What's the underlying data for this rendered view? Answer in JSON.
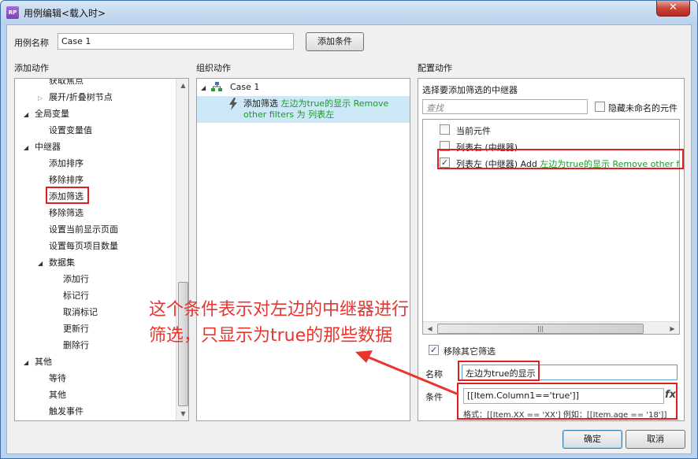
{
  "window": {
    "title": "用例编辑<载入时>",
    "app_icon_text": "RP",
    "close_glyph": "✕"
  },
  "top": {
    "case_name_label": "用例名称",
    "case_name_value": "Case 1",
    "add_condition_button": "添加条件"
  },
  "columns": {
    "add_action": "添加动作",
    "organize_action": "组织动作",
    "configure_action": "配置动作"
  },
  "action_tree": [
    {
      "label": "获取焦点",
      "indent": 2,
      "arrow": ""
    },
    {
      "label": "展开/折叠树节点",
      "indent": 2,
      "arrow": "right"
    },
    {
      "label": "全局变量",
      "indent": 1,
      "arrow": "down"
    },
    {
      "label": "设置变量值",
      "indent": 2,
      "arrow": ""
    },
    {
      "label": "中继器",
      "indent": 1,
      "arrow": "down"
    },
    {
      "label": "添加排序",
      "indent": 2,
      "arrow": ""
    },
    {
      "label": "移除排序",
      "indent": 2,
      "arrow": ""
    },
    {
      "label": "添加筛选",
      "indent": 2,
      "arrow": "",
      "highlight": true
    },
    {
      "label": "移除筛选",
      "indent": 2,
      "arrow": ""
    },
    {
      "label": "设置当前显示页面",
      "indent": 2,
      "arrow": ""
    },
    {
      "label": "设置每页项目数量",
      "indent": 2,
      "arrow": ""
    },
    {
      "label": "数据集",
      "indent": 2,
      "arrow": "down"
    },
    {
      "label": "添加行",
      "indent": 3,
      "arrow": ""
    },
    {
      "label": "标记行",
      "indent": 3,
      "arrow": ""
    },
    {
      "label": "取消标记",
      "indent": 3,
      "arrow": ""
    },
    {
      "label": "更新行",
      "indent": 3,
      "arrow": ""
    },
    {
      "label": "删除行",
      "indent": 3,
      "arrow": ""
    },
    {
      "label": "其他",
      "indent": 1,
      "arrow": "down"
    },
    {
      "label": "等待",
      "indent": 2,
      "arrow": ""
    },
    {
      "label": "其他",
      "indent": 2,
      "arrow": ""
    },
    {
      "label": "触发事件",
      "indent": 2,
      "arrow": ""
    }
  ],
  "organize": {
    "case_label": "Case 1",
    "action_verb": "添加筛选",
    "action_name": "左边为true的显示",
    "action_mid": "Remove other filters 为",
    "action_target": "列表左"
  },
  "configure": {
    "heading": "选择要添加筛选的中继器",
    "search_placeholder": "查找",
    "hide_unnamed_label": "隐藏未命名的元件",
    "hide_unnamed_checked": false,
    "targets": [
      {
        "label": "当前元件",
        "checked": false,
        "extra_black": "",
        "extra_green": "",
        "extra_tail": ""
      },
      {
        "label": "列表右 (中继器)",
        "checked": false,
        "extra_black": "",
        "extra_green": "",
        "extra_tail": ""
      },
      {
        "label": "列表左 (中继器)",
        "checked": true,
        "extra_black": "Add",
        "extra_green": "左边为true的显示",
        "extra_tail": "Remove other filters"
      }
    ],
    "remove_other_label": "移除其它筛选",
    "remove_other_checked": true,
    "name_label": "名称",
    "name_value": "左边为true的显示",
    "condition_label": "条件",
    "condition_value": "[[Item.Column1=='true']]",
    "fx_label": "fx",
    "format_hint": "格式：[[Item.XX == 'XX'] 例如：[[Item.age == '18']]"
  },
  "annotation": {
    "line1": "这个条件表示对左边的中继器进行",
    "line2": "筛选，只显示为true的那些数据"
  },
  "buttons": {
    "ok": "确定",
    "cancel": "取消"
  },
  "colors": {
    "accent_red": "#e02020",
    "annotation_red": "#e8352e",
    "selection": "#cde8f6",
    "green_text": "#1a9a28"
  }
}
